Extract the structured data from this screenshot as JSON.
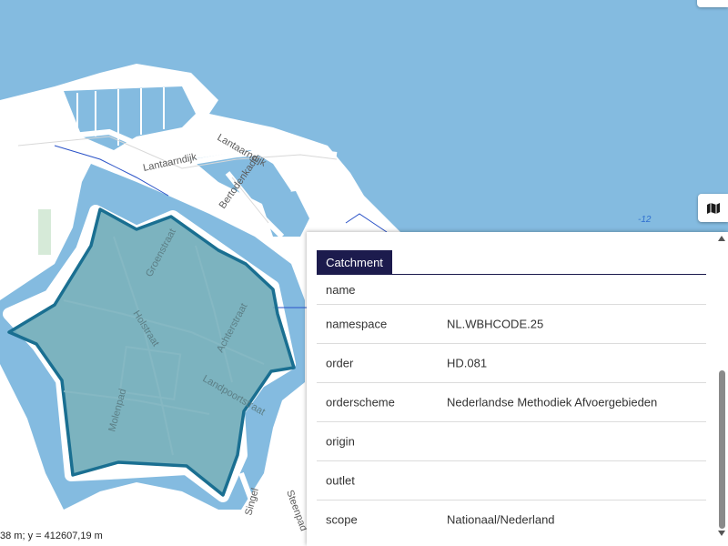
{
  "map": {
    "street_labels": [
      "Lantaarndijk",
      "Lantaarndijk",
      "Bertodenkade",
      "Groenstraat",
      "Holstraat",
      "Achterstraat",
      "Landpoortstraat",
      "Molenpad",
      "Singel",
      "Steenpad"
    ],
    "depth_label": "-12",
    "coordinates": "38 m; y = 412607,19 m",
    "colors": {
      "water": "#84bbe0",
      "land": "#ffffff",
      "catchment_fill": "#6aa9b6",
      "catchment_stroke": "#1a6f91"
    }
  },
  "controls": {
    "map_tool_icon": "map-layers-icon"
  },
  "panel": {
    "tab_label": "Catchment",
    "rows": [
      {
        "key": "name",
        "value": ""
      },
      {
        "key": "namespace",
        "value": "NL.WBHCODE.25"
      },
      {
        "key": "order",
        "value": "HD.081"
      },
      {
        "key": "orderscheme",
        "value": "Nederlandse Methodiek Afvoergebieden"
      },
      {
        "key": "origin",
        "value": ""
      },
      {
        "key": "outlet",
        "value": ""
      },
      {
        "key": "scope",
        "value": "Nationaal/Nederland"
      }
    ]
  }
}
